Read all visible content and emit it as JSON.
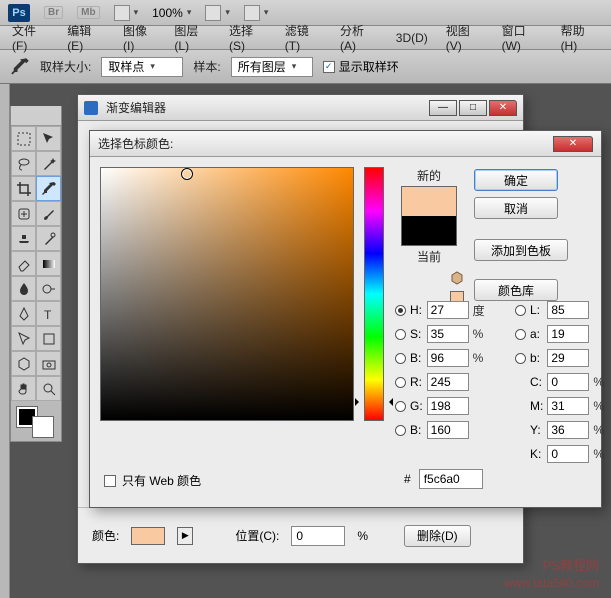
{
  "app": {
    "logo": "Ps",
    "badges": [
      "Br",
      "Mb"
    ],
    "zoom": "100%"
  },
  "menu": [
    "文件(F)",
    "编辑(E)",
    "图像(I)",
    "图层(L)",
    "选择(S)",
    "滤镜(T)",
    "分析(A)",
    "3D(D)",
    "视图(V)",
    "窗口(W)",
    "帮助(H)"
  ],
  "options": {
    "sample_size_label": "取样大小:",
    "sample_size_value": "取样点",
    "sample_label": "样本:",
    "sample_value": "所有图层",
    "show_ring_label": "显示取样环"
  },
  "gradient": {
    "title": "渐变编辑器",
    "color_label": "颜色:",
    "position_label": "位置(C):",
    "position_value": "0",
    "position_unit": "%",
    "delete_label": "删除(D)"
  },
  "picker": {
    "title": "选择色标颜色:",
    "new_label": "新的",
    "current_label": "当前",
    "buttons": {
      "ok": "确定",
      "cancel": "取消",
      "add": "添加到色板",
      "lib": "颜色库"
    },
    "hsb": {
      "H": {
        "v": "27",
        "u": "度"
      },
      "S": {
        "v": "35",
        "u": "%"
      },
      "B": {
        "v": "96",
        "u": "%"
      }
    },
    "rgb": {
      "R": "245",
      "G": "198",
      "B": "160"
    },
    "lab": {
      "L": "85",
      "a": "19",
      "b": "29"
    },
    "cmyk": {
      "C": {
        "v": "0",
        "u": "%"
      },
      "M": {
        "v": "31",
        "u": "%"
      },
      "Y": {
        "v": "36",
        "u": "%"
      },
      "K": {
        "v": "0",
        "u": "%"
      }
    },
    "hex_label": "#",
    "hex": "f5c6a0",
    "web_only": "只有 Web 颜色",
    "selected_model": "H"
  },
  "watermark": {
    "line1": "PS教程网",
    "line2": "www.tata580.com"
  }
}
